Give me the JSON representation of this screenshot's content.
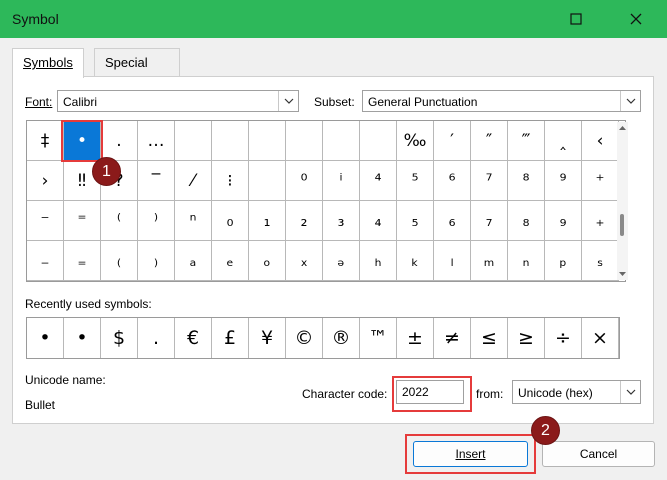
{
  "window": {
    "title": "Symbol"
  },
  "tabs": [
    {
      "label": "Symbols",
      "active": true
    },
    {
      "label": "Special Characters",
      "active": false
    }
  ],
  "font": {
    "label": "Font:",
    "value": "Calibri"
  },
  "subset": {
    "label": "Subset:",
    "value": "General Punctuation"
  },
  "symbol_grid": {
    "rows": [
      [
        "‡",
        "•",
        ".",
        "…",
        "",
        "",
        "",
        "",
        "",
        "",
        "‰",
        "′",
        "″",
        "‴",
        "‸",
        "‹"
      ],
      [
        "›",
        "‼",
        "‽",
        "‾",
        "⁄",
        "⁝",
        "",
        "⁰",
        "ⁱ",
        "⁴",
        "⁵",
        "⁶",
        "⁷",
        "⁸",
        "⁹",
        "⁺"
      ],
      [
        "⁻",
        "⁼",
        "⁽",
        "⁾",
        "ⁿ",
        "₀",
        "₁",
        "₂",
        "₃",
        "₄",
        "₅",
        "₆",
        "₇",
        "₈",
        "₉",
        "₊"
      ],
      [
        "₋",
        "₌",
        "₍",
        "₎",
        "ₐ",
        "ₑ",
        "ₒ",
        "ₓ",
        "ₔ",
        "ₕ",
        "ₖ",
        "ₗ",
        "ₘ",
        "ₙ",
        "ₚ",
        "ₛ"
      ]
    ],
    "selected": "•"
  },
  "recently_used": {
    "label": "Recently used symbols:",
    "symbols": [
      "•",
      "•",
      "$",
      ".",
      "€",
      "£",
      "¥",
      "©",
      "®",
      "™",
      "±",
      "≠",
      "≤",
      "≥",
      "÷",
      "×"
    ]
  },
  "unicode_name": {
    "label": "Unicode name:",
    "value": "Bullet"
  },
  "character_code": {
    "label": "Character code:",
    "value": "2022"
  },
  "from": {
    "label": "from:",
    "value": "Unicode (hex)"
  },
  "buttons": {
    "insert": "Insert",
    "cancel": "Cancel"
  },
  "callouts": [
    "1",
    "2"
  ],
  "colors": {
    "titlebar": "#2db85a",
    "selection": "#0a78d7",
    "highlight": "#e53b3b",
    "badge": "#8b1a1a"
  }
}
